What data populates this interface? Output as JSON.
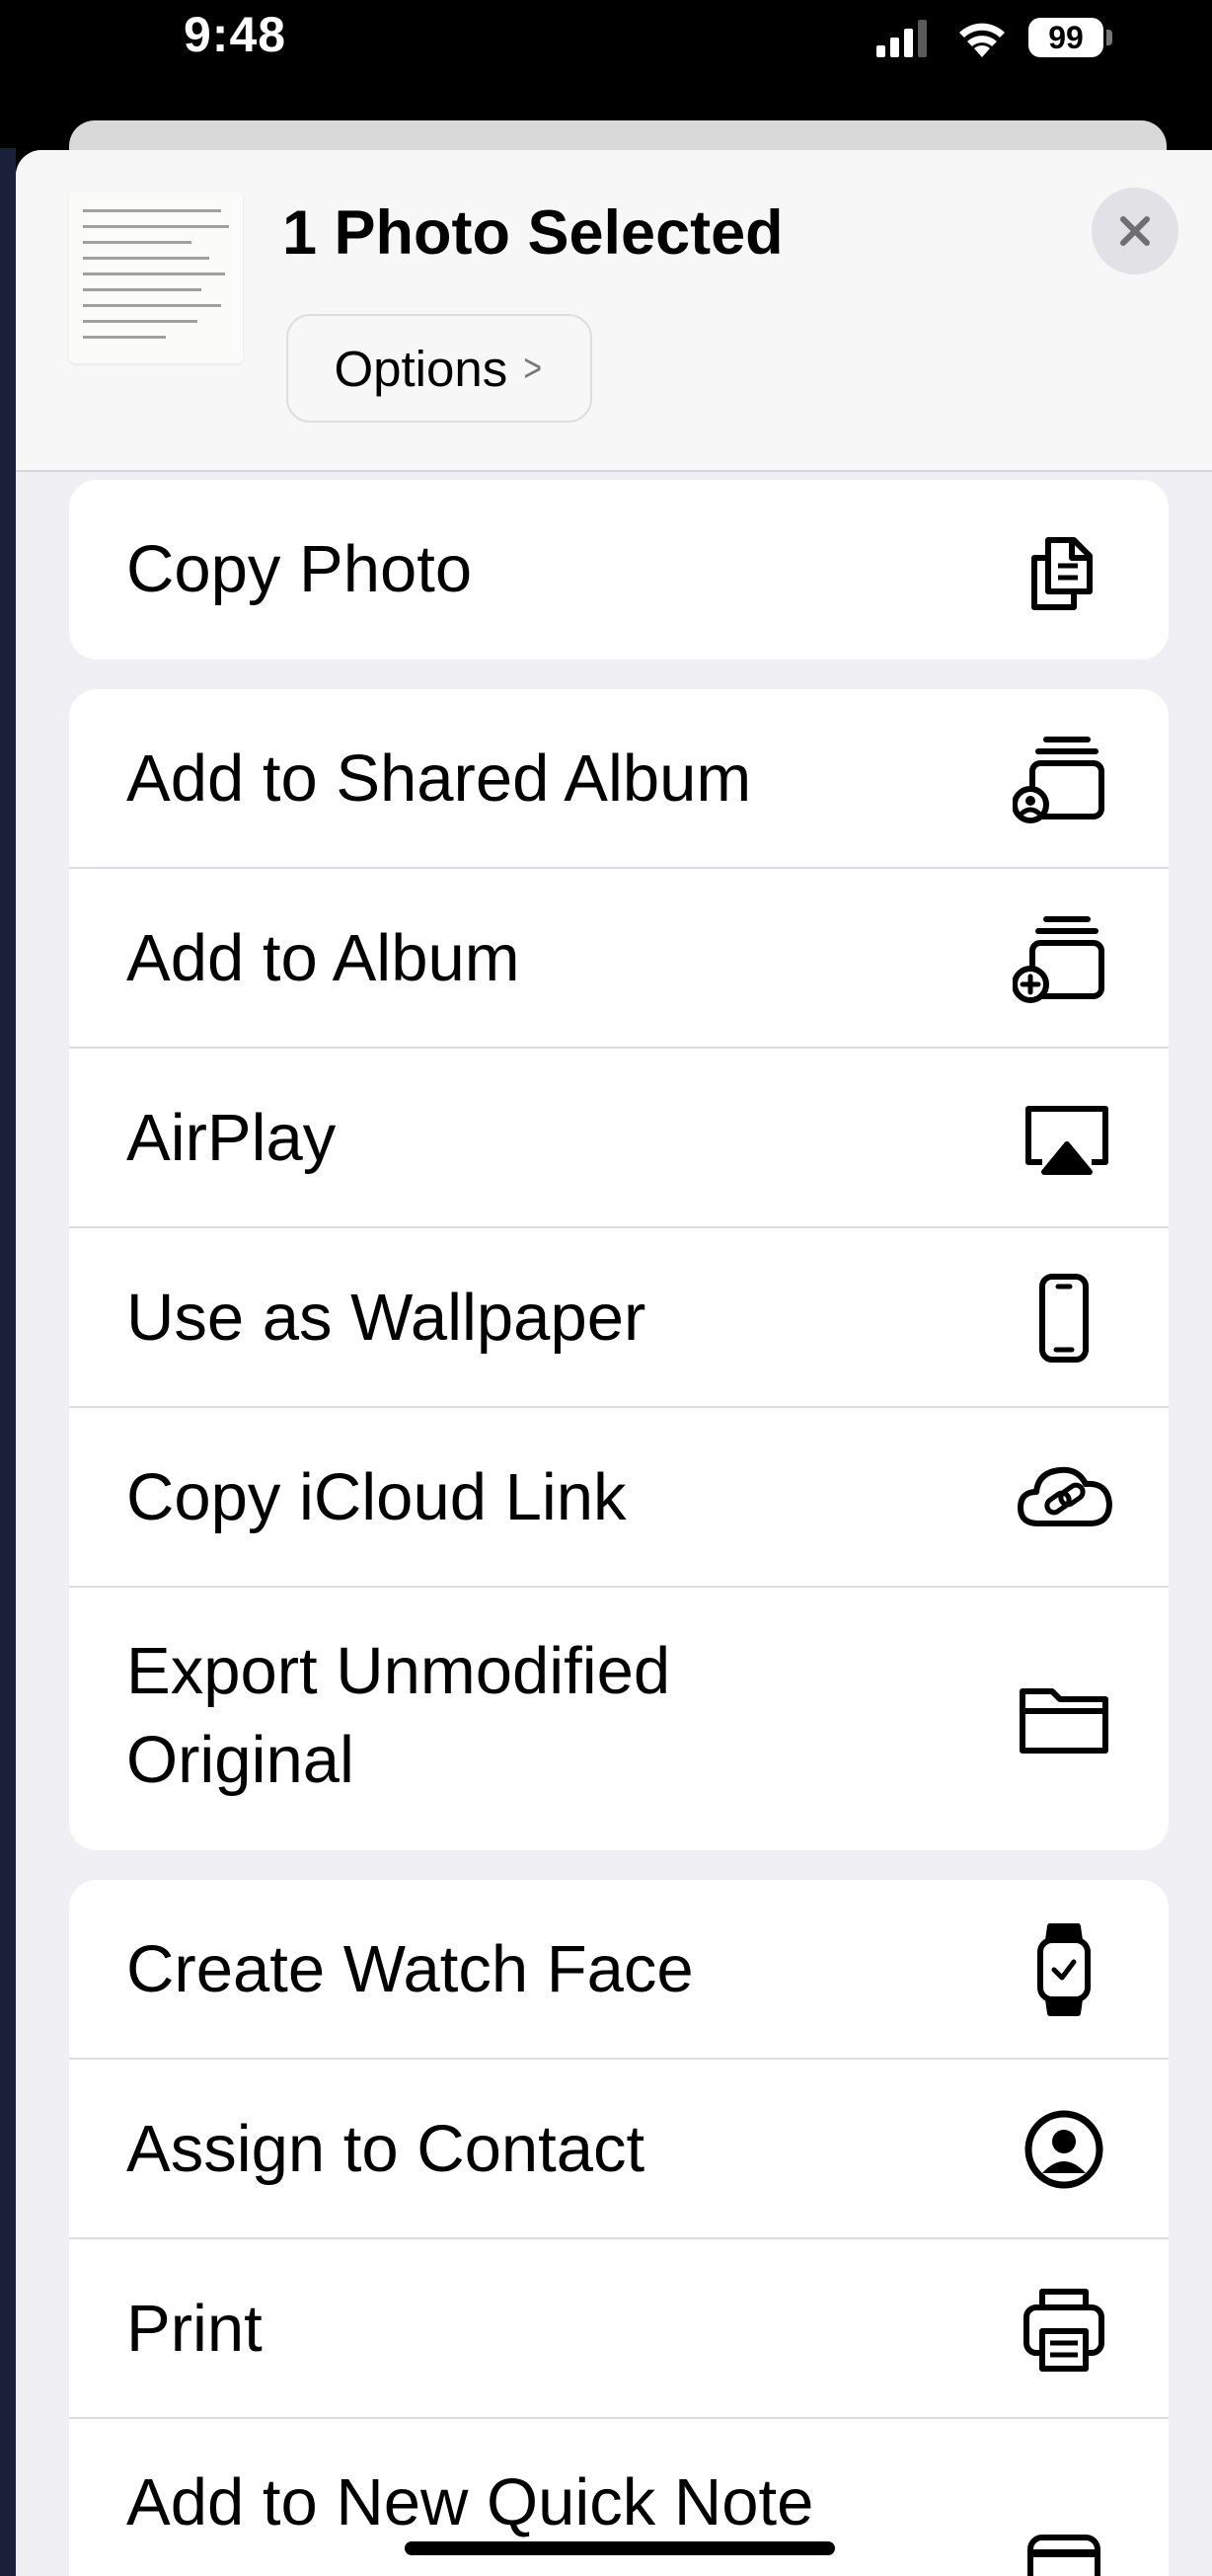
{
  "status_bar": {
    "time": "9:48",
    "battery": "99",
    "icons": [
      "cellular-signal-icon",
      "wifi-icon",
      "battery-icon"
    ]
  },
  "share_sheet": {
    "title": "1 Photo Selected",
    "options_label": "Options",
    "options_chevron": ">",
    "close_icon": "close-icon",
    "groups": [
      {
        "items": [
          {
            "label": "Copy Photo",
            "icon": "copy-icon"
          }
        ]
      },
      {
        "items": [
          {
            "label": "Add to Shared Album",
            "icon": "shared-album-icon"
          },
          {
            "label": "Add to Album",
            "icon": "add-album-icon"
          },
          {
            "label": "AirPlay",
            "icon": "airplay-icon"
          },
          {
            "label": "Use as Wallpaper",
            "icon": "phone-icon"
          },
          {
            "label": "Copy iCloud Link",
            "icon": "icloud-link-icon"
          },
          {
            "label": "Export Unmodified Original",
            "icon": "folder-icon"
          }
        ]
      },
      {
        "items": [
          {
            "label": "Create Watch Face",
            "icon": "watch-icon"
          },
          {
            "label": "Assign to Contact",
            "icon": "contact-icon"
          },
          {
            "label": "Print",
            "icon": "printer-icon"
          },
          {
            "label": "Add to New Quick Note",
            "icon": "quick-note-icon"
          }
        ]
      }
    ]
  }
}
